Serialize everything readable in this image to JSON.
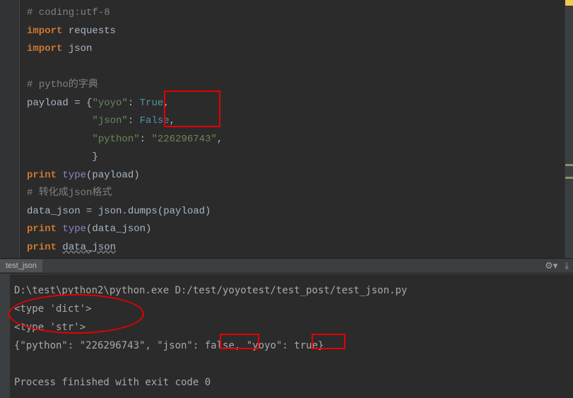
{
  "tabbar": {
    "tab_label": "test_json"
  },
  "editor": {
    "l1_comment": "# coding:utf-8",
    "l2_kw": "import",
    "l2_mod": " requests",
    "l3_kw": "import",
    "l3_mod": " json",
    "l5_comment": "# pytho的字典",
    "l6_a": "payload ",
    "l6_eq": "=",
    "l6_b": " {",
    "l6_k1": "\"yoyo\"",
    "l6_c": ": ",
    "l6_v1": "True",
    "l6_d": ",",
    "l7_a": "           ",
    "l7_k": "\"json\"",
    "l7_b": ": ",
    "l7_v": "False",
    "l7_c": ",",
    "l8_a": "           ",
    "l8_k": "\"python\"",
    "l8_b": ": ",
    "l8_v": "\"226296743\"",
    "l8_c": ",",
    "l9_a": "           }",
    "l10_kw": "print",
    "l10_sp": " ",
    "l10_fn": "type",
    "l10_b": "(payload)",
    "l11_comment": "# 转化成json格式",
    "l12_a": "data_json ",
    "l12_eq": "=",
    "l12_b": " json.dumps(payload)",
    "l13_kw": "print",
    "l13_sp": " ",
    "l13_fn": "type",
    "l13_b": "(data_json)",
    "l14_kw": "print",
    "l14_sp": " ",
    "l14_var": "data_json"
  },
  "console": {
    "c1": "D:\\test\\python2\\python.exe D:/test/yoyotest/test_post/test_json.py",
    "c2": "<type 'dict'>",
    "c3": "<type 'str'>",
    "c4a": "{\"python\": \"226296743\", \"json\": ",
    "c4_false": "false",
    "c4b": ", \"yoyo\": ",
    "c4_true": "true",
    "c4c": "}",
    "c6": "Process finished with exit code 0"
  }
}
